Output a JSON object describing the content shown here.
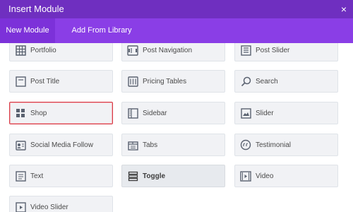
{
  "window": {
    "title": "Insert Module",
    "close_glyph": "×"
  },
  "tabs": [
    {
      "label": "New Module",
      "active": true
    },
    {
      "label": "Add From Library",
      "active": false
    }
  ],
  "modules": [
    {
      "label": "Portfolio",
      "icon": "portfolio-icon"
    },
    {
      "label": "Post Navigation",
      "icon": "post-navigation-icon"
    },
    {
      "label": "Post Slider",
      "icon": "post-slider-icon"
    },
    {
      "label": "Post Title",
      "icon": "post-title-icon"
    },
    {
      "label": "Pricing Tables",
      "icon": "pricing-tables-icon"
    },
    {
      "label": "Search",
      "icon": "search-icon"
    },
    {
      "label": "Shop",
      "icon": "shop-icon",
      "selected": true
    },
    {
      "label": "Sidebar",
      "icon": "sidebar-icon"
    },
    {
      "label": "Slider",
      "icon": "slider-icon"
    },
    {
      "label": "Social Media Follow",
      "icon": "social-media-follow-icon"
    },
    {
      "label": "Tabs",
      "icon": "tabs-icon"
    },
    {
      "label": "Testimonial",
      "icon": "testimonial-icon"
    },
    {
      "label": "Text",
      "icon": "text-icon"
    },
    {
      "label": "Toggle",
      "icon": "toggle-icon",
      "highlighted": true
    },
    {
      "label": "Video",
      "icon": "video-icon"
    },
    {
      "label": "Video Slider",
      "icon": "video-slider-icon"
    }
  ],
  "colors": {
    "titlebar": "#6f2fc0",
    "tabbar": "#8a3ee6",
    "selected_border": "#d63a46",
    "module_bg": "#f1f2f5"
  }
}
